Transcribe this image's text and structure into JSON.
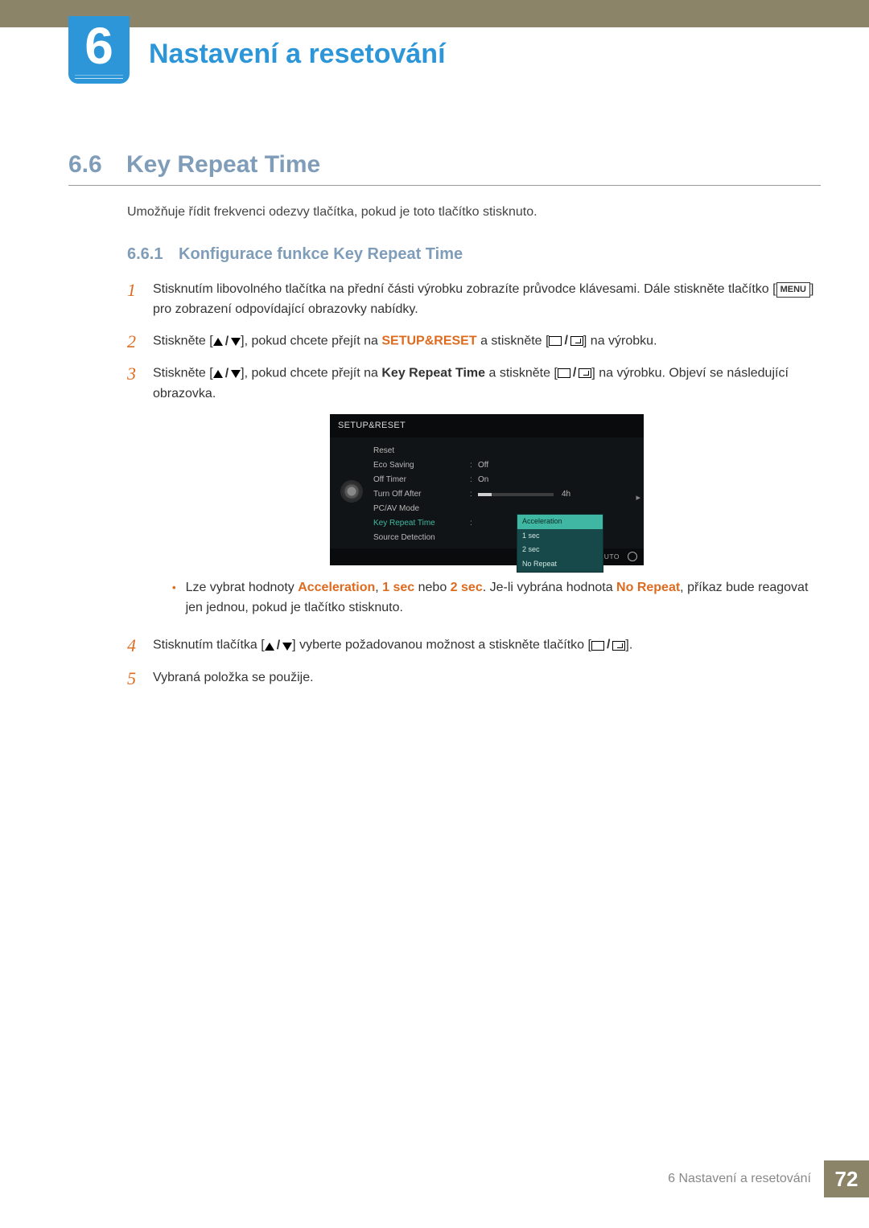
{
  "chapter": {
    "number": "6",
    "title": "Nastavení a resetování"
  },
  "section": {
    "number": "6.6",
    "title": "Key Repeat Time"
  },
  "intro": "Umožňuje řídit frekvenci odezvy tlačítka, pokud je toto tlačítko stisknuto.",
  "subsection": {
    "number": "6.6.1",
    "title": "Konfigurace funkce Key Repeat Time"
  },
  "steps": {
    "s1": {
      "a": "Stisknutím libovolného tlačítka na přední části výrobku zobrazíte průvodce klávesami. Dále stiskněte tlačítko [",
      "menu": "MENU",
      "b": "] pro zobrazení odpovídající obrazovky nabídky."
    },
    "s2": {
      "a": "Stiskněte [",
      "b": "], pokud chcete přejít na ",
      "hl": "SETUP&RESET",
      "c": " a stiskněte [",
      "d": "] na výrobku."
    },
    "s3": {
      "a": "Stiskněte [",
      "b": "], pokud chcete přejít na ",
      "bold": "Key Repeat Time",
      "c": " a stiskněte [",
      "d": "] na výrobku. Objeví se následující obrazovka."
    },
    "bullet": {
      "a": "Lze vybrat hodnoty ",
      "h1": "Acceleration",
      "comma": ", ",
      "h2": "1 sec",
      "mid": " nebo ",
      "h3": "2 sec",
      "b": ". Je-li vybrána hodnota ",
      "h4": "No Repeat",
      "c": ", příkaz bude reagovat jen jednou, pokud je tlačítko stisknuto."
    },
    "s4": {
      "a": "Stisknutím tlačítka [",
      "b": "] vyberte požadovanou možnost a stiskněte tlačítko [",
      "c": "]."
    },
    "s5": "Vybraná položka se použije."
  },
  "osd": {
    "header": "SETUP&RESET",
    "rows": {
      "reset": "Reset",
      "eco": "Eco Saving",
      "eco_v": "Off",
      "offt": "Off Timer",
      "offt_v": "On",
      "toa": "Turn Off After",
      "toa_v": "4h",
      "pcav": "PC/AV Mode",
      "krt": "Key Repeat Time",
      "srcd": "Source Detection"
    },
    "options": {
      "o1": "Acceleration",
      "o2": "1 sec",
      "o3": "2 sec",
      "o4": "No Repeat"
    },
    "auto": "AUTO"
  },
  "footer": {
    "text": "6 Nastavení a resetování",
    "page": "72"
  }
}
